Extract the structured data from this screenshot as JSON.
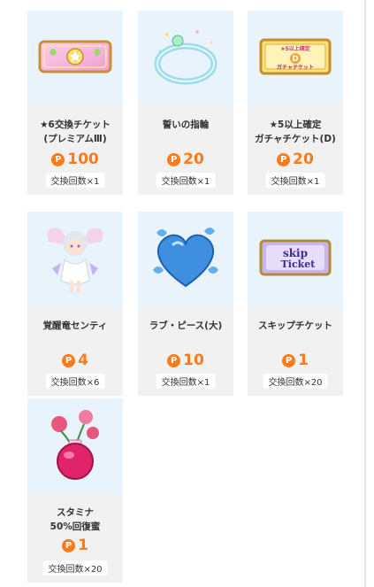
{
  "coin_symbol": "P",
  "items": [
    {
      "name": "★6交換チケット\n(プレミアムⅢ)",
      "price": "100",
      "limit": "交換回数×1",
      "icon": "ticket-premium-icon"
    },
    {
      "name": "誓いの指輪",
      "price": "20",
      "limit": "交換回数×1",
      "icon": "ring-icon"
    },
    {
      "name": "★5以上確定\nガチャチケット(D)",
      "price": "20",
      "limit": "交換回数×1",
      "icon": "gacha-ticket-icon",
      "icon_text": "★5以上確定",
      "icon_letter": "D",
      "icon_subtext": "ガチャチケット"
    },
    {
      "name": "覚醒竜センティ",
      "price": "4",
      "limit": "交換回数×6",
      "icon": "dragon-sentry-icon"
    },
    {
      "name": "ラブ・ピース(大)",
      "price": "10",
      "limit": "交換回数×1",
      "icon": "heart-icon"
    },
    {
      "name": "スキップチケット",
      "price": "1",
      "limit": "交換回数×20",
      "icon": "skip-ticket-icon",
      "icon_text_1": "skip",
      "icon_text_2": "Ticket"
    },
    {
      "name": "スタミナ\n50%回復蜜",
      "price": "1",
      "limit": "交換回数×20",
      "icon": "stamina-potion-icon"
    }
  ]
}
